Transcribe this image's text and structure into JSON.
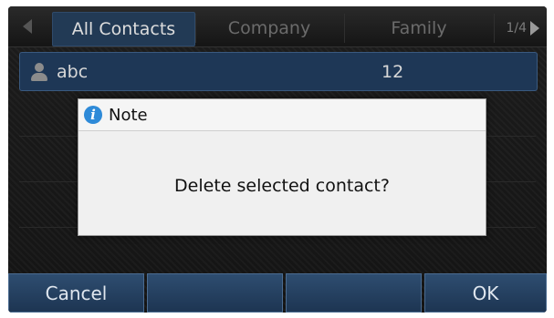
{
  "tabs": {
    "items": [
      {
        "label": "All Contacts",
        "active": true
      },
      {
        "label": "Company",
        "active": false
      },
      {
        "label": "Family",
        "active": false
      }
    ],
    "page_indicator": "1/4"
  },
  "contact": {
    "name": "abc",
    "number": "12"
  },
  "dialog": {
    "title": "Note",
    "message": "Delete selected contact?"
  },
  "softkeys": {
    "left": "Cancel",
    "middle1": "",
    "middle2": "",
    "right": "OK"
  },
  "colors": {
    "accent": "#223a55",
    "dialog_bg": "#f0f0f0",
    "info_icon": "#2e8ad8"
  }
}
